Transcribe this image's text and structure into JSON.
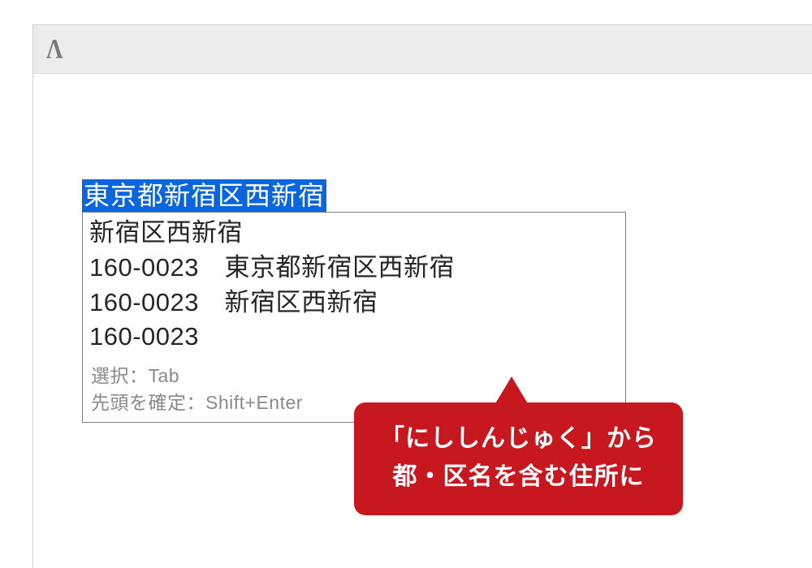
{
  "ime": {
    "selected_text": "東京都新宿区西新宿",
    "candidates": [
      "新宿区西新宿",
      "160-0023　東京都新宿区西新宿",
      "160-0023　新宿区西新宿",
      "160-0023"
    ],
    "hints": {
      "select": "選択：Tab",
      "confirm_first": "先頭を確定：Shift+Enter"
    }
  },
  "callout": {
    "line1": "「にししんじゅく」から",
    "line2": "都・区名を含む住所に"
  }
}
